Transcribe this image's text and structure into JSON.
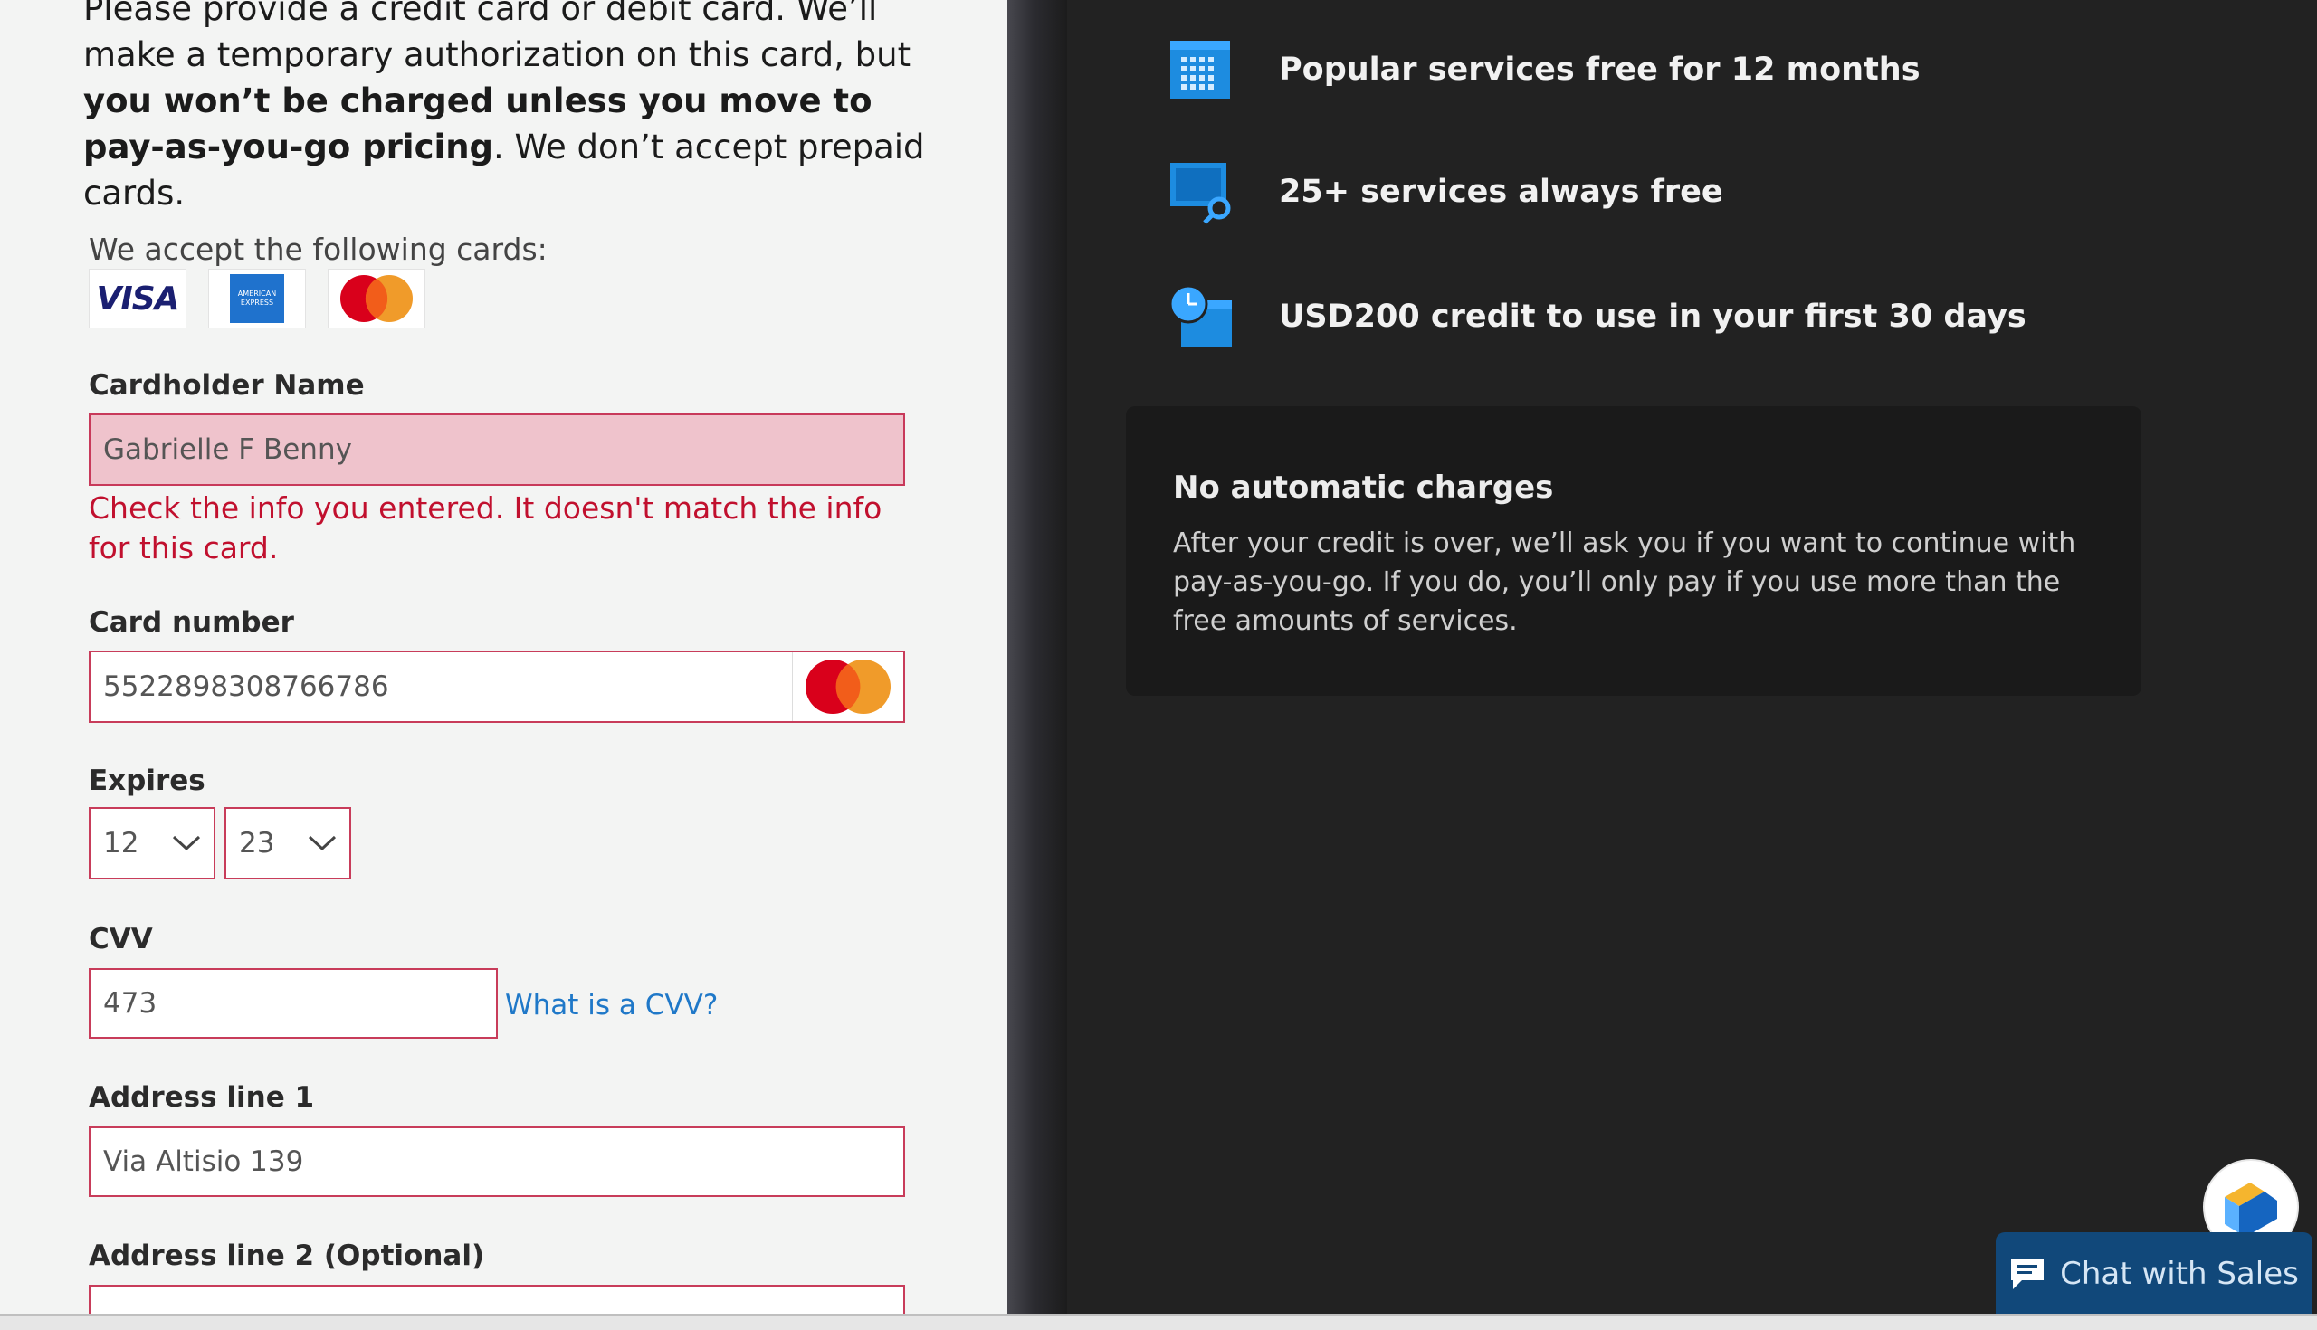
{
  "intro": {
    "line_prefix": "Please provide a credit card or debit card. We’ll make a temporary authorization on this card, but ",
    "line_bold": "you won’t be charged unless you move to pay-as-you-go pricing",
    "line_suffix": ". We don’t accept prepaid cards."
  },
  "accepted_cards": {
    "label": "We accept the following cards:",
    "visa": "VISA",
    "amex": "AMERICAN EXPRESS"
  },
  "form": {
    "cardholder_label": "Cardholder Name",
    "cardholder_value": "Gabrielle F Benny",
    "cardholder_error": "Check the info you entered. It doesn't match the info for this card.",
    "card_number_label": "Card number",
    "card_number_value": "5522898308766786",
    "expires_label": "Expires",
    "expires_month": "12",
    "expires_year": "23",
    "cvv_label": "CVV",
    "cvv_value": "473",
    "cvv_help_link": "What is a CVV?",
    "address1_label": "Address line 1",
    "address1_value": "Via Altisio 139",
    "address2_label": "Address line 2 (Optional)",
    "address2_value": ""
  },
  "benefits": [
    {
      "icon": "calendar-grid-icon",
      "text": "Popular services free for 12 months"
    },
    {
      "icon": "monitor-search-icon",
      "text": "25+ services always free"
    },
    {
      "icon": "clock-calendar-icon",
      "text": "USD200 credit to use in your first 30 days"
    }
  ],
  "info_card": {
    "title": "No automatic charges",
    "body": "After your credit is over, we’ll ask you if you want to continue with pay-as-you-go. If you do, you’ll only pay if you use more than the free amounts of services."
  },
  "chat": {
    "label": "Chat with Sales"
  },
  "colors": {
    "error": "#c1102e",
    "link": "#1f78c8",
    "chat_bg": "#11487a",
    "icon_blue": "#1d8ce0"
  }
}
